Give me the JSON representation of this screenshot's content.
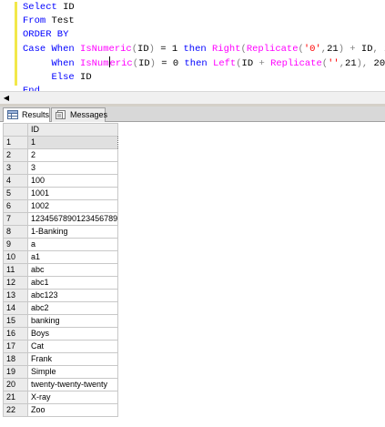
{
  "editor": {
    "lines": [
      [
        {
          "t": "Select ",
          "c": "kw"
        },
        {
          "t": "ID",
          "c": ""
        }
      ],
      [
        {
          "t": "From ",
          "c": "kw"
        },
        {
          "t": "Test",
          "c": ""
        }
      ],
      [
        {
          "t": "ORDER BY",
          "c": "kw"
        }
      ],
      [
        {
          "t": "Case When ",
          "c": "kw"
        },
        {
          "t": "IsNumeric",
          "c": "fn"
        },
        {
          "t": "(",
          "c": "op"
        },
        {
          "t": "ID",
          "c": ""
        },
        {
          "t": ")",
          "c": "op"
        },
        {
          "t": " = 1 ",
          "c": ""
        },
        {
          "t": "then ",
          "c": "kw"
        },
        {
          "t": "Right",
          "c": "fn"
        },
        {
          "t": "(",
          "c": "op"
        },
        {
          "t": "Replicate",
          "c": "fn"
        },
        {
          "t": "(",
          "c": "op"
        },
        {
          "t": "'0'",
          "c": "str"
        },
        {
          "t": ",",
          "c": "op"
        },
        {
          "t": "21",
          "c": ""
        },
        {
          "t": ")",
          "c": "op"
        },
        {
          "t": " + ",
          "c": "op"
        },
        {
          "t": "ID",
          "c": ""
        },
        {
          "t": ",",
          "c": "op"
        },
        {
          "t": " 20",
          "c": ""
        },
        {
          "t": ")",
          "c": "op"
        }
      ],
      [
        {
          "t": "     When ",
          "c": "kw"
        },
        {
          "t": "IsNum",
          "c": "fn"
        },
        {
          "t": "|",
          "c": "caret"
        },
        {
          "t": "eric",
          "c": "fn"
        },
        {
          "t": "(",
          "c": "op"
        },
        {
          "t": "ID",
          "c": ""
        },
        {
          "t": ")",
          "c": "op"
        },
        {
          "t": " = 0 ",
          "c": ""
        },
        {
          "t": "then ",
          "c": "kw"
        },
        {
          "t": "Left",
          "c": "fn"
        },
        {
          "t": "(",
          "c": "op"
        },
        {
          "t": "ID",
          "c": ""
        },
        {
          "t": " + ",
          "c": "op"
        },
        {
          "t": "Replicate",
          "c": "fn"
        },
        {
          "t": "(",
          "c": "op"
        },
        {
          "t": "''",
          "c": "str"
        },
        {
          "t": ",",
          "c": "op"
        },
        {
          "t": "21",
          "c": ""
        },
        {
          "t": "),",
          "c": "op"
        },
        {
          "t": " 20",
          "c": ""
        },
        {
          "t": ")",
          "c": "op"
        }
      ],
      [
        {
          "t": "     Else ",
          "c": "kw"
        },
        {
          "t": "ID",
          "c": ""
        }
      ],
      [
        {
          "t": "End",
          "c": "kw"
        }
      ]
    ]
  },
  "tabs": {
    "results_label": "Results",
    "messages_label": "Messages"
  },
  "grid": {
    "column_header": "ID",
    "rows": [
      {
        "n": "1",
        "v": "1"
      },
      {
        "n": "2",
        "v": "2"
      },
      {
        "n": "3",
        "v": "3"
      },
      {
        "n": "4",
        "v": "100"
      },
      {
        "n": "5",
        "v": "1001"
      },
      {
        "n": "6",
        "v": "1002"
      },
      {
        "n": "7",
        "v": "123456789012345678­9"
      },
      {
        "n": "8",
        "v": "1-Banking"
      },
      {
        "n": "9",
        "v": "a"
      },
      {
        "n": "10",
        "v": "a1"
      },
      {
        "n": "11",
        "v": "abc"
      },
      {
        "n": "12",
        "v": "abc1"
      },
      {
        "n": "13",
        "v": "abc123"
      },
      {
        "n": "14",
        "v": "abc2"
      },
      {
        "n": "15",
        "v": "banking"
      },
      {
        "n": "16",
        "v": "Boys"
      },
      {
        "n": "17",
        "v": "Cat"
      },
      {
        "n": "18",
        "v": "Frank"
      },
      {
        "n": "19",
        "v": "Simple"
      },
      {
        "n": "20",
        "v": "twenty-twenty-twenty"
      },
      {
        "n": "21",
        "v": "X-ray"
      },
      {
        "n": "22",
        "v": "Zoo"
      }
    ]
  }
}
